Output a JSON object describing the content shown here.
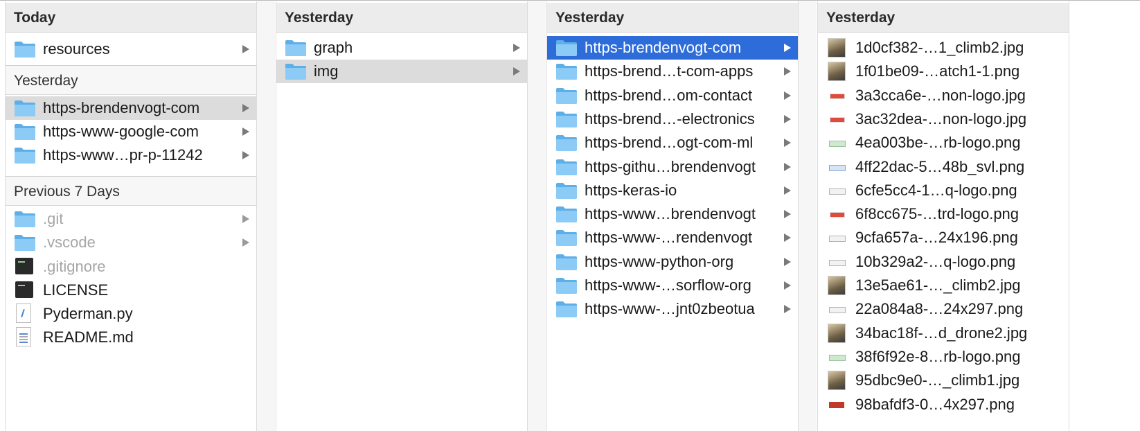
{
  "colors": {
    "selection_blue": "#2e6dd9",
    "selection_grey": "#dcdcdc",
    "folder_blue": "#6cb8ee"
  },
  "column1": {
    "sections": [
      {
        "header": "Today",
        "items": [
          {
            "label": "resources",
            "icon": "folder-icon",
            "has_children": true
          }
        ]
      },
      {
        "header": "Yesterday",
        "items": [
          {
            "label": "https-brendenvogt-com",
            "icon": "folder-icon",
            "has_children": true,
            "selected": "grey"
          },
          {
            "label": "https-www-google-com",
            "icon": "folder-icon",
            "has_children": true
          },
          {
            "label": "https-www…pr-p-11242",
            "icon": "folder-icon",
            "has_children": true
          }
        ]
      },
      {
        "header": "Previous 7 Days",
        "items": [
          {
            "label": ".git",
            "icon": "folder-icon",
            "has_children": true,
            "dimmed": true
          },
          {
            "label": ".vscode",
            "icon": "folder-icon",
            "has_children": true,
            "dimmed": true
          },
          {
            "label": ".gitignore",
            "icon": "terminal-file-icon",
            "dimmed": true
          },
          {
            "label": "LICENSE",
            "icon": "terminal-file-icon"
          },
          {
            "label": "Pyderman.py",
            "icon": "python-file-icon"
          },
          {
            "label": "README.md",
            "icon": "markdown-file-icon"
          }
        ]
      }
    ]
  },
  "column2": {
    "header": "Yesterday",
    "items": [
      {
        "label": "graph",
        "icon": "folder-icon",
        "has_children": true
      },
      {
        "label": "img",
        "icon": "folder-icon",
        "has_children": true,
        "selected": "grey"
      }
    ]
  },
  "column3": {
    "header": "Yesterday",
    "items": [
      {
        "label": "https-brendenvogt-com",
        "selected": "blue"
      },
      {
        "label": "https-brend…t-com-apps"
      },
      {
        "label": "https-brend…om-contact"
      },
      {
        "label": "https-brend…-electronics"
      },
      {
        "label": "https-brend…ogt-com-ml"
      },
      {
        "label": "https-githu…brendenvogt"
      },
      {
        "label": "https-keras-io"
      },
      {
        "label": "https-www…brendenvogt"
      },
      {
        "label": "https-www-…rendenvogt"
      },
      {
        "label": "https-www-python-org"
      },
      {
        "label": "https-www-…sorflow-org"
      },
      {
        "label": "https-www-…jnt0zbeotua"
      }
    ]
  },
  "column4": {
    "header": "Yesterday",
    "items": [
      {
        "label": "1d0cf382-…1_climb2.jpg",
        "thumb": "photo"
      },
      {
        "label": "1f01be09-…atch1-1.png",
        "thumb": "photo"
      },
      {
        "label": "3a3cca6e-…non-logo.jpg",
        "thumb": "logo-red"
      },
      {
        "label": "3ac32dea-…non-logo.jpg",
        "thumb": "logo-red"
      },
      {
        "label": "4ea003be-…rb-logo.png",
        "thumb": "logo-green"
      },
      {
        "label": "4ff22dac-5…48b_svl.png",
        "thumb": "logo-blue"
      },
      {
        "label": "6cfe5cc4-1…q-logo.png",
        "thumb": "logo-grey"
      },
      {
        "label": "6f8cc675-…trd-logo.png",
        "thumb": "logo-red"
      },
      {
        "label": "9cfa657a-…24x196.png",
        "thumb": "logo-grey"
      },
      {
        "label": "10b329a2-…q-logo.png",
        "thumb": "logo-grey"
      },
      {
        "label": "13e5ae61-…_climb2.jpg",
        "thumb": "photo"
      },
      {
        "label": "22a084a8-…24x297.png",
        "thumb": "logo-grey"
      },
      {
        "label": "34bac18f-…d_drone2.jpg",
        "thumb": "photo"
      },
      {
        "label": "38f6f92e-8…rb-logo.png",
        "thumb": "logo-green"
      },
      {
        "label": "95dbc9e0-…_climb1.jpg",
        "thumb": "photo"
      },
      {
        "label": "98bafdf3-0…4x297.png",
        "thumb": "logo-darkred"
      }
    ]
  }
}
